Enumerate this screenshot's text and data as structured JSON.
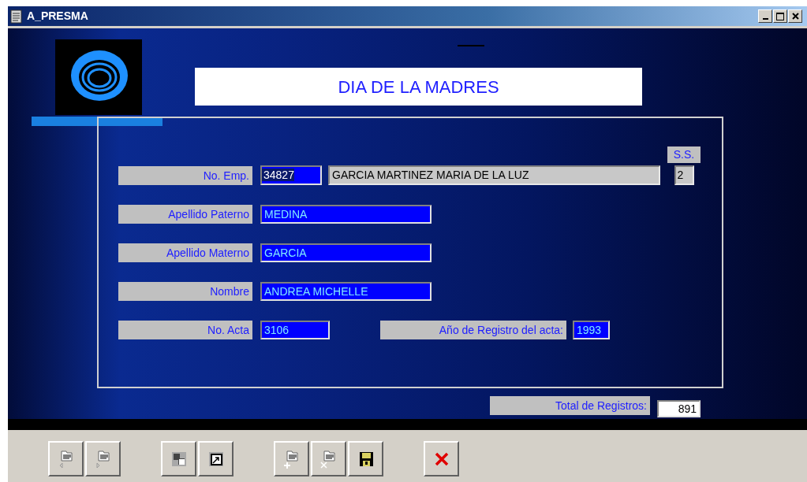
{
  "window": {
    "title": "A_PRESMA"
  },
  "header": {
    "title": "DIA DE LA MADRES"
  },
  "employee": {
    "label": "No. Emp.",
    "value": "34827",
    "text_selected": true,
    "name": "GARCIA MARTINEZ MARIA DE LA LUZ",
    "ss_label": "S.S.",
    "ss_value": "2"
  },
  "fields": [
    {
      "label": "Apellido Paterno",
      "value": "MEDINA"
    },
    {
      "label": "Apellido Materno",
      "value": "GARCIA"
    },
    {
      "label": "Nombre",
      "value": "ANDREA MICHELLE"
    }
  ],
  "acta": {
    "label": "No. Acta",
    "value": "3106",
    "year_label": "Año de Registro del acta:",
    "year_value": "1993"
  },
  "total": {
    "label": "Total de Registros:",
    "value": "891"
  },
  "toolbar_groups": [
    {
      "buttons": [
        {
          "kind": "previous"
        },
        {
          "kind": "next"
        }
      ]
    },
    {
      "buttons": [
        {
          "kind": "copy"
        },
        {
          "kind": "export"
        }
      ]
    },
    {
      "buttons": [
        {
          "kind": "add"
        },
        {
          "kind": "delete"
        },
        {
          "kind": "save"
        }
      ]
    },
    {
      "buttons": [
        {
          "kind": "close"
        }
      ]
    }
  ]
}
